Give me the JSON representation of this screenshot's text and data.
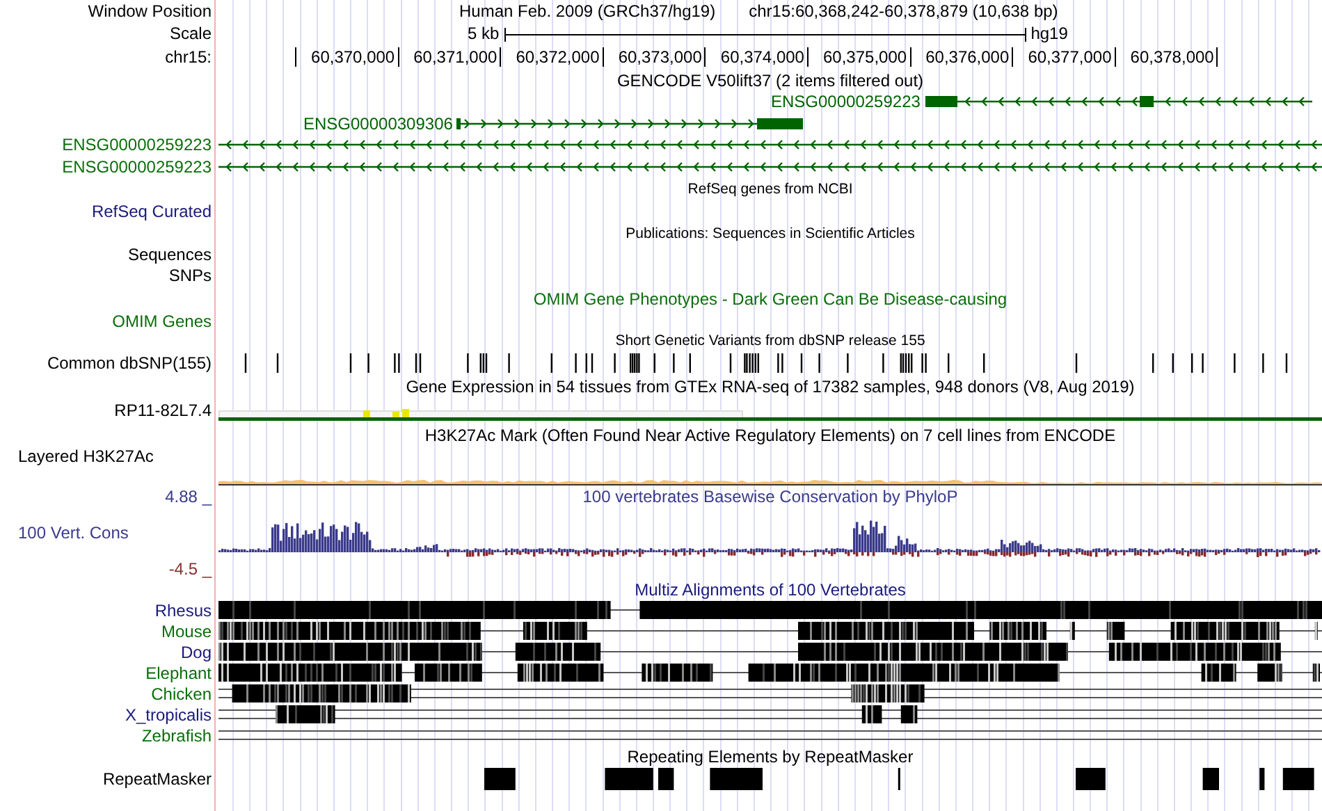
{
  "position": {
    "label": "Window Position",
    "assembly": "Human Feb. 2009 (GRCh37/hg19)",
    "range": "chr15:60,368,242-60,378,879 (10,638 bp)"
  },
  "scale": {
    "label": "Scale",
    "length": "5 kb",
    "assembly": "hg19"
  },
  "ruler": {
    "label": "chr15:",
    "ticks": [
      "60,370,000",
      "60,371,000",
      "60,372,000",
      "60,373,000",
      "60,374,000",
      "60,375,000",
      "60,376,000",
      "60,377,000",
      "60,378,000"
    ]
  },
  "gencode": {
    "title": "GENCODE V50lift37 (2 items filtered out)",
    "genes": [
      {
        "name": "ENSG00000259223",
        "reverse": true
      },
      {
        "name": "ENSG00000309306",
        "reverse": false
      },
      {
        "name": "ENSG00000259223",
        "reverse": true
      },
      {
        "name": "ENSG00000259223",
        "reverse": true
      }
    ]
  },
  "refseq": {
    "title": "RefSeq genes from NCBI",
    "label": "RefSeq Curated"
  },
  "publications": {
    "title": "Publications: Sequences in Scientific Articles",
    "labels": [
      "Sequences",
      "SNPs"
    ]
  },
  "omim": {
    "title": "OMIM Gene Phenotypes - Dark Green Can Be Disease-causing",
    "label": "OMIM Genes"
  },
  "dbsnp": {
    "title": "Short Genetic Variants from dbSNP release 155",
    "label": "Common dbSNP(155)"
  },
  "gtex": {
    "title": "Gene Expression in 54 tissues from GTEx RNA-seq of 17382 samples, 948 donors (V8, Aug 2019)",
    "label": "RP11-82L7.4"
  },
  "h3k27ac": {
    "title": "H3K27Ac Mark (Often Found Near Active Regulatory Elements) on 7 cell lines from ENCODE",
    "label": "Layered H3K27Ac"
  },
  "phylop": {
    "title": "100 vertebrates Basewise Conservation by PhyloP",
    "label": "100 Vert. Cons",
    "max": "4.88 _",
    "min": "-4.5 _"
  },
  "multiz": {
    "title": "Multiz Alignments of 100 Vertebrates",
    "species": [
      {
        "name": "Rhesus",
        "color": "#1a1a7e"
      },
      {
        "name": "Mouse",
        "color": "#0b6e0b"
      },
      {
        "name": "Dog",
        "color": "#1a1a7e"
      },
      {
        "name": "Elephant",
        "color": "#0b6e0b"
      },
      {
        "name": "Chicken",
        "color": "#0b6e0b"
      },
      {
        "name": "X_tropicalis",
        "color": "#1a1a7e"
      },
      {
        "name": "Zebrafish",
        "color": "#0b6e0b"
      }
    ]
  },
  "repeatmasker": {
    "title": "Repeating Elements by RepeatMasker",
    "label": "RepeatMasker"
  }
}
